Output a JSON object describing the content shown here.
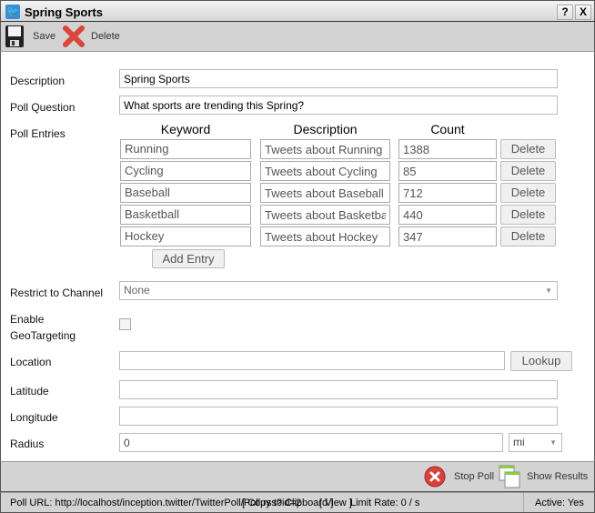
{
  "window": {
    "title": "Spring Sports",
    "help": "?",
    "close": "X"
  },
  "toolbar": {
    "save": "Save",
    "delete": "Delete"
  },
  "form": {
    "description_label": "Description",
    "description_value": "Spring Sports",
    "question_label": "Poll Question",
    "question_value": "What sports are trending this Spring?",
    "entries_label": "Poll Entries",
    "headers": {
      "keyword": "Keyword",
      "description": "Description",
      "count": "Count"
    },
    "entries": [
      {
        "keyword": "Running",
        "description": "Tweets about Running",
        "count": "1388"
      },
      {
        "keyword": "Cycling",
        "description": "Tweets about Cycling",
        "count": "85"
      },
      {
        "keyword": "Baseball",
        "description": "Tweets about Baseball",
        "count": "712"
      },
      {
        "keyword": "Basketball",
        "description": "Tweets about Basketball",
        "count": "440"
      },
      {
        "keyword": "Hockey",
        "description": "Tweets about Hockey",
        "count": "347"
      }
    ],
    "delete_label": "Delete",
    "add_entry": "Add Entry",
    "channel_label": "Restrict to Channel",
    "channel_value": "None",
    "geo_label_1": "Enable",
    "geo_label_2": "GeoTargeting",
    "geo_checked": false,
    "location_label": "Location",
    "location_value": "",
    "lookup": "Lookup",
    "latitude_label": "Latitude",
    "latitude_value": "",
    "longitude_label": "Longitude",
    "longitude_value": "",
    "radius_label": "Radius",
    "radius_value": "0",
    "radius_unit": "mi"
  },
  "actions": {
    "stop_poll": "Stop Poll",
    "show_results": "Show Results"
  },
  "status": {
    "url": "Poll URL: http://localhost/inception.twitter/TwitterPoll/Poll.rss?id=2",
    "copy": "[ Copy to Clipboard ]",
    "view": "[ View ]",
    "rate": "Limit Rate: 0 / s",
    "active": "Active: Yes"
  }
}
